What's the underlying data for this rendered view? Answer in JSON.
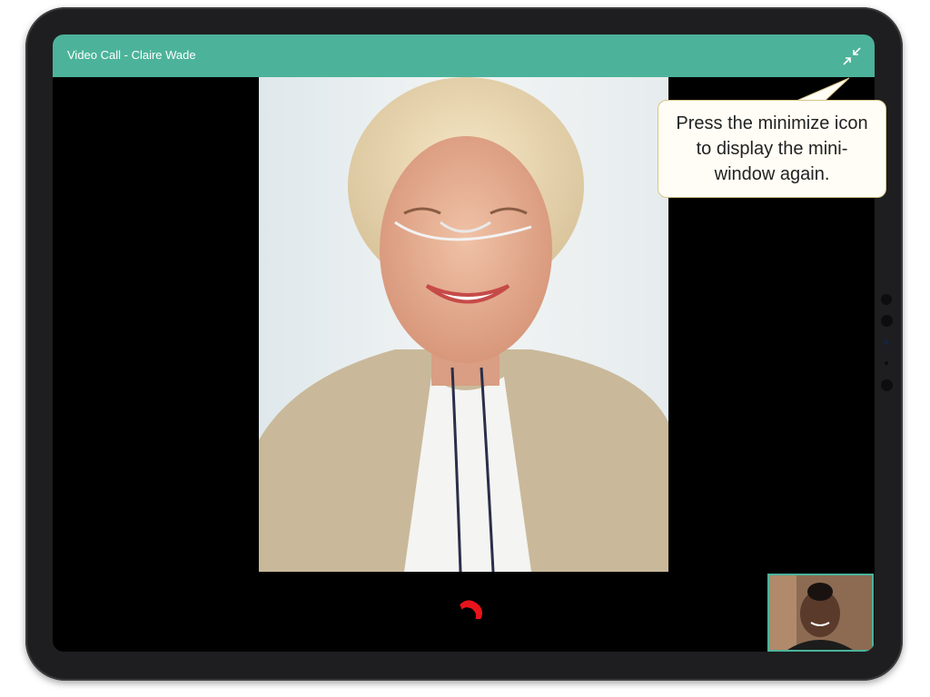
{
  "window": {
    "title": "Video Call - Claire Wade"
  },
  "header": {
    "minimize_icon": "minimize-icon"
  },
  "callout": {
    "text": "Press the minimize icon to display the mini-window again."
  },
  "controls": {
    "end_call_icon": "end-call-icon",
    "end_call_color": "#e8141b"
  },
  "video": {
    "main_participant": "Claire Wade",
    "self_view": "self-view-thumbnail"
  },
  "colors": {
    "header": "#4cb39a",
    "background": "#000000",
    "self_view_border": "#4cb39a"
  }
}
